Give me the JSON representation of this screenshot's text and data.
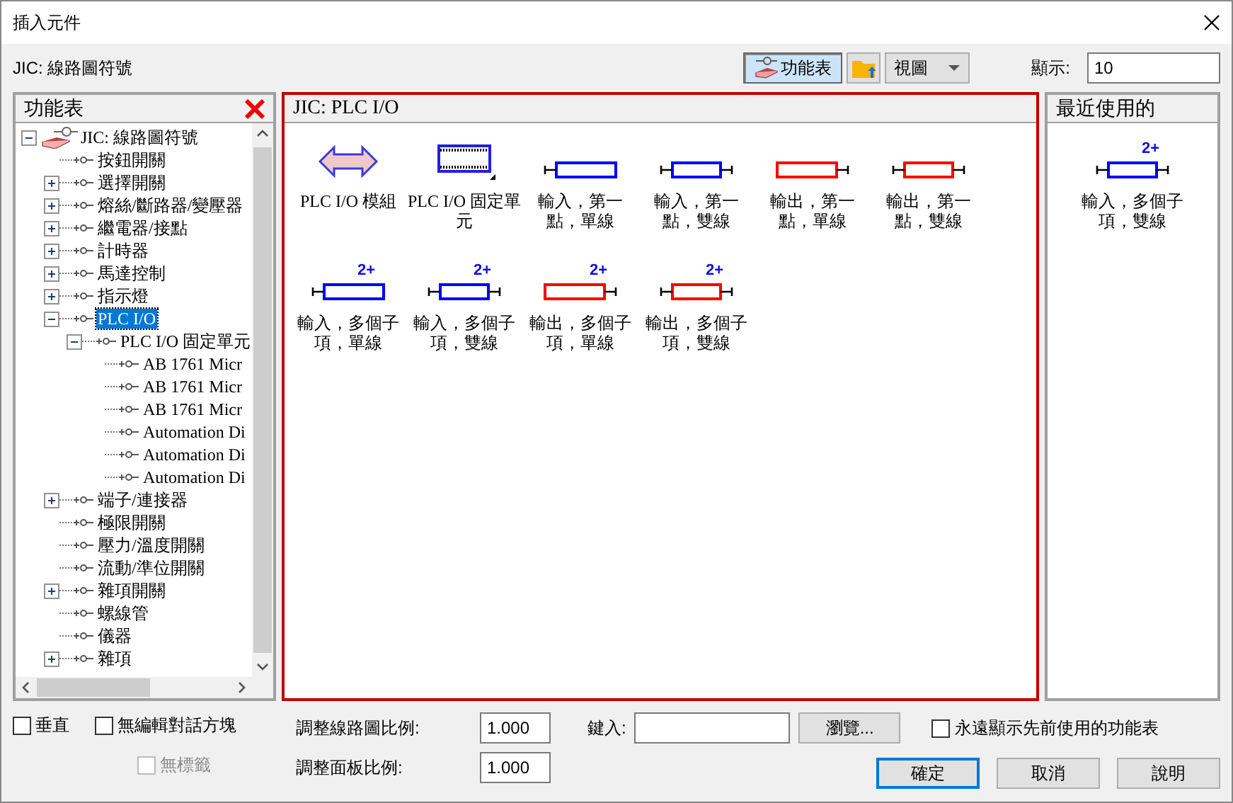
{
  "window": {
    "title": "插入元件"
  },
  "library_label": "JIC: 線路圖符號",
  "toolbar": {
    "menu_button": {
      "label": "功能表",
      "pressed": true
    },
    "view_button": {
      "label": "視圖"
    },
    "display_label": "顯示:",
    "display_value": "10"
  },
  "menu_panel": {
    "title": "功能表",
    "tree": [
      {
        "label": "JIC: 線路圖符號",
        "kind": "root",
        "expanded": true,
        "selected": false,
        "children": [
          {
            "label": "按鈕開關",
            "kind": "symbol",
            "selected": false
          },
          {
            "label": "選擇開關",
            "kind": "symbol",
            "expanded": false,
            "selected": false
          },
          {
            "label": "熔絲/斷路器/變壓器",
            "kind": "symbol",
            "expanded": false,
            "selected": false
          },
          {
            "label": "繼電器/接點",
            "kind": "symbol",
            "expanded": false,
            "selected": false
          },
          {
            "label": "計時器",
            "kind": "symbol",
            "expanded": false,
            "selected": false
          },
          {
            "label": "馬達控制",
            "kind": "symbol",
            "expanded": false,
            "selected": false
          },
          {
            "label": "指示燈",
            "kind": "symbol",
            "expanded": false,
            "selected": false
          },
          {
            "label": "PLC I/O",
            "kind": "symbol",
            "expanded": true,
            "selected": true,
            "children": [
              {
                "label": "PLC I/O 固定單元",
                "kind": "symbol",
                "expanded": true,
                "selected": false,
                "children": [
                  {
                    "label": "AB 1761 Micr",
                    "kind": "symbol",
                    "selected": false
                  },
                  {
                    "label": "AB 1761 Micr",
                    "kind": "symbol",
                    "selected": false
                  },
                  {
                    "label": "AB 1761 Micr",
                    "kind": "symbol",
                    "selected": false
                  },
                  {
                    "label": "Automation Di",
                    "kind": "symbol",
                    "selected": false
                  },
                  {
                    "label": "Automation Di",
                    "kind": "symbol",
                    "selected": false
                  },
                  {
                    "label": "Automation Di",
                    "kind": "symbol",
                    "selected": false
                  }
                ]
              }
            ]
          },
          {
            "label": "端子/連接器",
            "kind": "symbol",
            "expanded": false,
            "selected": false
          },
          {
            "label": "極限開關",
            "kind": "symbol",
            "selected": false
          },
          {
            "label": "壓力/溫度開關",
            "kind": "symbol",
            "selected": false
          },
          {
            "label": "流動/準位開關",
            "kind": "symbol",
            "selected": false
          },
          {
            "label": "雜項開關",
            "kind": "symbol",
            "expanded": false,
            "selected": false
          },
          {
            "label": "螺線管",
            "kind": "symbol",
            "selected": false
          },
          {
            "label": "儀器",
            "kind": "symbol",
            "selected": false
          },
          {
            "label": "雜項",
            "kind": "symbol",
            "expanded": false,
            "selected": false
          }
        ]
      }
    ]
  },
  "symbols_panel": {
    "title": "JIC: PLC I/O",
    "items": [
      {
        "kind": "module",
        "label": "PLC I/O 模組"
      },
      {
        "kind": "fixed-unit",
        "label": "PLC I/O 固定單元"
      },
      {
        "kind": "input",
        "color": "#0000ff",
        "double": false,
        "label": "輸入，第一點，單線"
      },
      {
        "kind": "input",
        "color": "#0000ff",
        "double": true,
        "label": "輸入，第一點，雙線"
      },
      {
        "kind": "output",
        "color": "#ff0000",
        "double": false,
        "label": "輸出，第一點，單線"
      },
      {
        "kind": "output",
        "color": "#ff0000",
        "double": true,
        "label": "輸出，第一點，雙線"
      },
      {
        "kind": "input",
        "color": "#0000ff",
        "double": false,
        "badge": "2+",
        "label": "輸入，多個子項，單線"
      },
      {
        "kind": "input",
        "color": "#0000ff",
        "double": true,
        "badge": "2+",
        "label": "輸入，多個子項，雙線"
      },
      {
        "kind": "output",
        "color": "#ff0000",
        "double": false,
        "badge": "2+",
        "label": "輸出，多個子項，單線"
      },
      {
        "kind": "output",
        "color": "#ff0000",
        "double": true,
        "badge": "2+",
        "label": "輸出，多個子項，雙線"
      }
    ]
  },
  "recent_panel": {
    "title": "最近使用的",
    "items": [
      {
        "kind": "input",
        "color": "#0000ff",
        "double": true,
        "badge": "2+",
        "label": "輸入，多個子項，雙線"
      }
    ]
  },
  "options": [
    {
      "label": "垂直",
      "checked": false,
      "disabled": false
    },
    {
      "label": "無編輯對話方塊",
      "checked": false,
      "disabled": false
    },
    {
      "label": "無標籤",
      "checked": false,
      "disabled": true
    }
  ],
  "scale_fields": [
    {
      "label": "調整線路圖比例:",
      "value": "1.000"
    },
    {
      "label": "調整面板比例:",
      "value": "1.000"
    }
  ],
  "key_in": {
    "label": "鍵入:",
    "browse_button": "瀏覽..."
  },
  "always_show": {
    "label": "永遠顯示先前使用的功能表",
    "checked": false
  },
  "buttons": [
    {
      "label": "確定",
      "default": true
    },
    {
      "label": "取消",
      "default": false
    },
    {
      "label": "說明",
      "default": false
    }
  ]
}
